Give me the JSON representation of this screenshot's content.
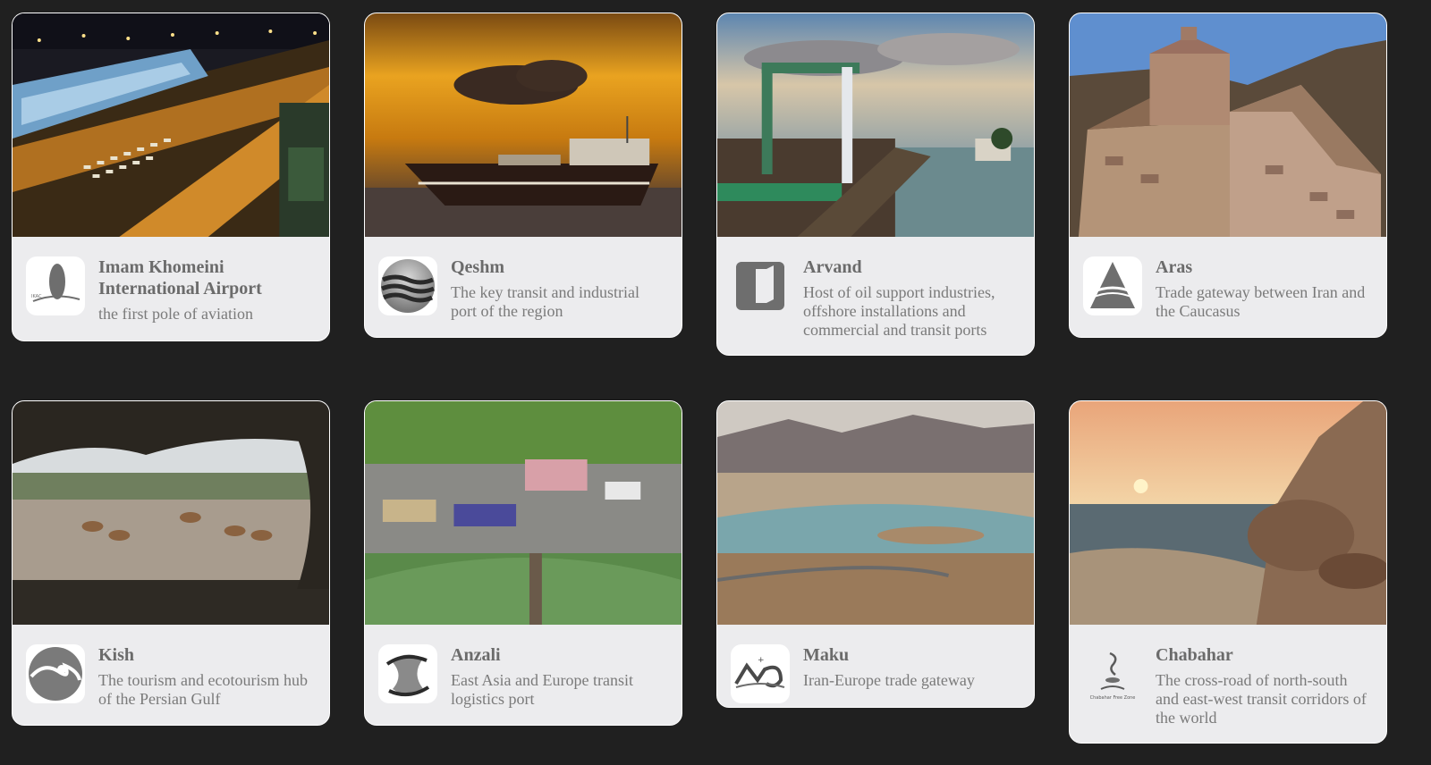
{
  "cards": [
    {
      "title": "Imam Khomeini International Airport",
      "description": "the first pole of aviation",
      "logo_icon": "airport-logo-icon",
      "image": "airport-night-photo"
    },
    {
      "title": "Qeshm",
      "description": "The key transit and industrial port of the region",
      "logo_icon": "qeshm-waves-logo-icon",
      "image": "dhow-sunset-photo"
    },
    {
      "title": "Arvand",
      "description": "Host of oil support industries, offshore installations and commercial and transit ports",
      "logo_icon": "arvand-logo-icon",
      "image": "boat-river-photo"
    },
    {
      "title": "Aras",
      "description": "Trade gateway between Iran and the Caucasus",
      "logo_icon": "aras-mountain-logo-icon",
      "image": "church-photo"
    },
    {
      "title": "Kish",
      "description": "The tourism and ecotourism hub of the Persian Gulf",
      "logo_icon": "kish-wave-logo-icon",
      "image": "gazelles-photo"
    },
    {
      "title": "Anzali",
      "description": "East Asia and Europe transit logistics port",
      "logo_icon": "anzali-logo-icon",
      "image": "aerial-port-photo"
    },
    {
      "title": "Maku",
      "description": "Iran-Europe trade gateway",
      "logo_icon": "maku-logo-icon",
      "image": "mountain-lake-photo"
    },
    {
      "title": "Chabahar",
      "description": "The cross-road of north-south and east-west transit corridors of the world",
      "logo_icon": "chabahar-logo-icon",
      "image": "coast-sunset-photo",
      "logo_caption": "Chabahar Free Zone"
    }
  ]
}
